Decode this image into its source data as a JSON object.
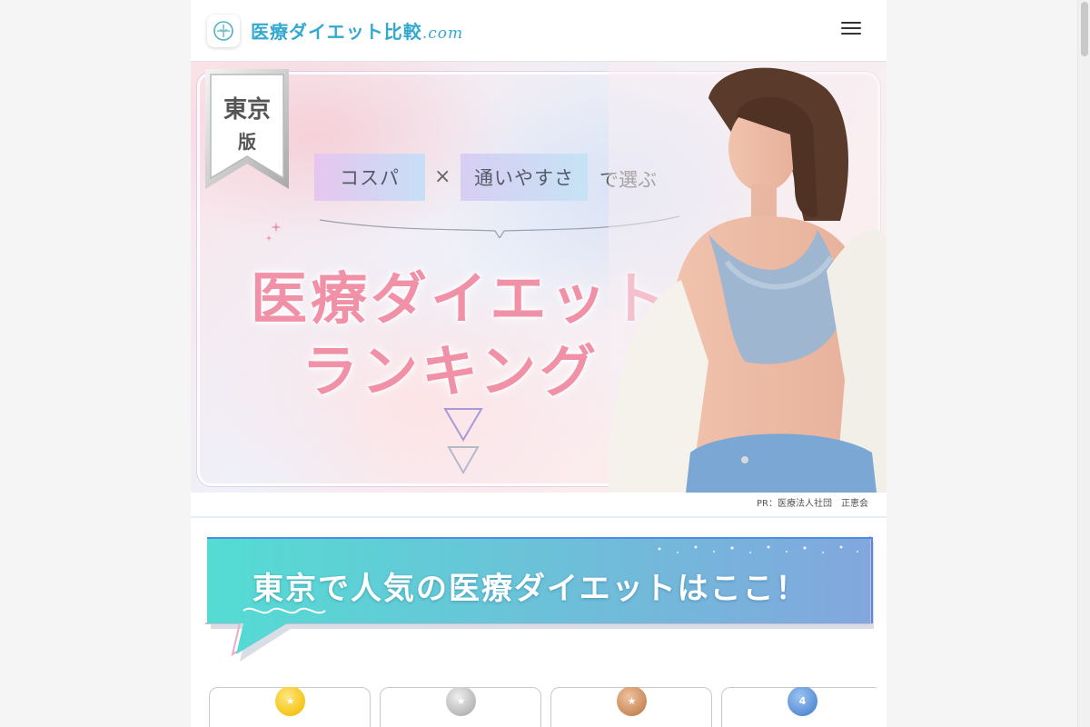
{
  "header": {
    "logo_main": "医療ダイエット比較",
    "logo_domain": ".com",
    "logo_icon": "leaf-circle-icon",
    "menu_icon": "hamburger-menu-icon"
  },
  "hero": {
    "ribbon_line1": "東京",
    "ribbon_line2": "版",
    "tag1": "コスパ",
    "times": "×",
    "tag2": "通いやすさ",
    "tag_suffix": "で選ぶ",
    "title_line1": "医療ダイエット",
    "title_line2": "ランキング",
    "photo_alt": "woman-model-photo"
  },
  "pr_text": "PR：医療法人社団　正恵会",
  "banner": {
    "text": "東京で人気の医療ダイエットはここ！"
  },
  "cards": [
    {
      "rank": "1",
      "medal": "gold-crown-medal-icon",
      "medal_color": "#f5c518"
    },
    {
      "rank": "2",
      "medal": "silver-crown-medal-icon",
      "medal_color": "#b8b8b8"
    },
    {
      "rank": "3",
      "medal": "bronze-crown-medal-icon",
      "medal_color": "#c98a5a"
    },
    {
      "rank": "4",
      "medal": "blue-rank-medal-icon",
      "medal_color": "#5a8fd6",
      "label": "4"
    }
  ],
  "colors": {
    "brand": "#34a9cf",
    "title_pink": "#f191a8",
    "banner_teal": "#4fdbd3",
    "banner_blue": "#7ea6dd"
  }
}
